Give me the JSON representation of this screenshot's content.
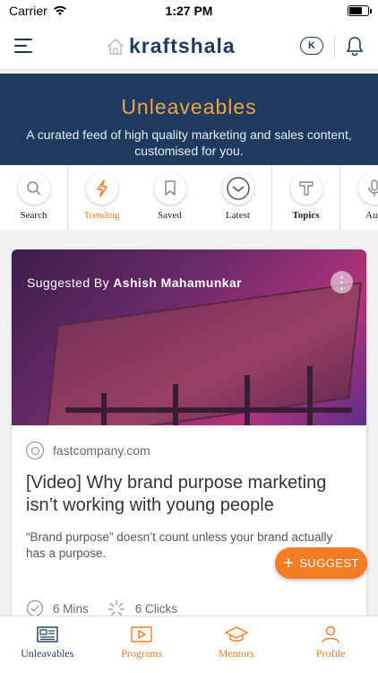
{
  "status_bar": {
    "carrier": "Carrier",
    "time": "1:27 PM",
    "battery_level": 0.7
  },
  "header": {
    "brand": "kraftshala",
    "badge": "K"
  },
  "hero": {
    "title": "Unleaveables",
    "subtitle": "A curated feed of high quality marketing and sales content, customised for you."
  },
  "nav": {
    "items": [
      {
        "label": "Search",
        "icon": "search-icon"
      },
      {
        "label": "Trending",
        "icon": "lightning-icon"
      },
      {
        "label": "Saved",
        "icon": "bookmark-icon"
      },
      {
        "label": "Latest",
        "icon": "clock-icon"
      },
      {
        "label": "Topics",
        "icon": "topics-icon"
      },
      {
        "label": "Aud",
        "icon": "microphone-icon"
      }
    ],
    "active": "Trending"
  },
  "card": {
    "suggested_prefix": "Suggested By",
    "suggested_name": "Ashish Mahamunkar",
    "source": "fastcompany.com",
    "title": "[Video] Why brand purpose marketing isn’t working with young people",
    "excerpt": "“Brand purpose” doesn’t count unless your brand actually has a purpose.",
    "duration": "6 Mins",
    "clicks": "6 Clicks"
  },
  "suggest_button": {
    "label": "SUGGEST"
  },
  "bottom_nav": {
    "tabs": [
      {
        "label": "Unleavables",
        "icon": "newspaper-icon"
      },
      {
        "label": "Programs",
        "icon": "play-icon"
      },
      {
        "label": "Mentors",
        "icon": "graduation-cap-icon"
      },
      {
        "label": "Profile",
        "icon": "user-icon"
      }
    ],
    "active": "Unleavables"
  },
  "colors": {
    "primary": "#1e3a5f",
    "accent": "#f07b24",
    "hero_title": "#f0a44a"
  }
}
